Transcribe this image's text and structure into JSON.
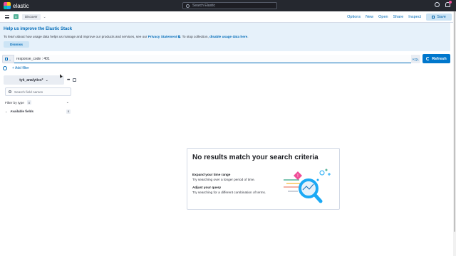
{
  "header": {
    "logo_text": "elastic",
    "search_placeholder": "Search Elastic"
  },
  "subbar": {
    "space_initial": "D",
    "breadcrumb": "Discover",
    "links": [
      "Options",
      "New",
      "Open",
      "Share",
      "Inspect"
    ],
    "save_label": "Save"
  },
  "callout": {
    "title": "Help us improve the Elastic Stack",
    "body_prefix": "To learn about how usage data helps us manage and improve our products and services, see our ",
    "privacy_link": "Privacy Statement",
    "body_middle": ". To stop collection, ",
    "disable_link": "disable usage data here",
    "body_suffix": ".",
    "dismiss_label": "Dismiss"
  },
  "query": {
    "value": "response_code : 401",
    "language": "KQL",
    "refresh_label": "Refresh",
    "add_filter_label": "+ Add filter"
  },
  "sidebar": {
    "index_pattern": "tyk_analytics*",
    "field_search_placeholder": "Search field names",
    "filter_by_type_label": "Filter by type",
    "filter_count": "0",
    "available_fields_label": "Available fields",
    "available_count": "0"
  },
  "empty_state": {
    "title": "No results match your search criteria",
    "tip1_heading": "Expand your time range",
    "tip1_text": "Try searching over a longer period of time.",
    "tip2_heading": "Adjust your query",
    "tip2_text": "Try searching for a different combination of terms."
  },
  "colors": {
    "header_bg": "#25282f",
    "accent": "#006bb8",
    "primary_button": "#0077cc",
    "callout_bg": "#e6f1fa"
  }
}
